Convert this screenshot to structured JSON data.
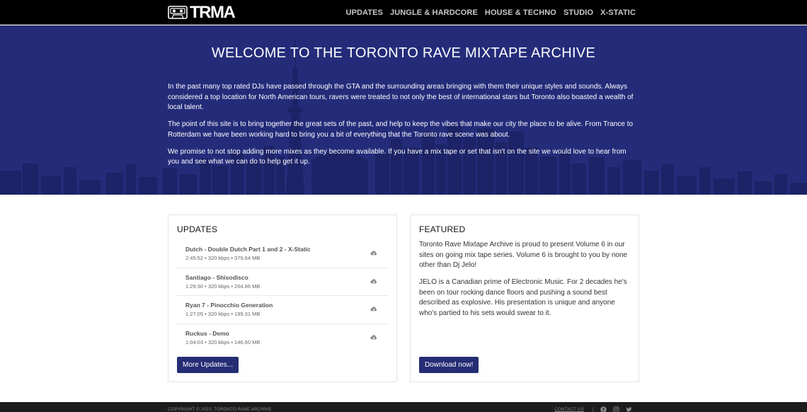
{
  "brand": {
    "logo_text": "TRMA"
  },
  "nav": {
    "items": [
      {
        "label": "UPDATES"
      },
      {
        "label": "JUNGLE & HARDCORE"
      },
      {
        "label": "HOUSE & TECHNO"
      },
      {
        "label": "STUDIO"
      },
      {
        "label": "X-STATIC"
      }
    ]
  },
  "hero": {
    "title": "WELCOME TO THE TORONTO RAVE MIXTAPE ARCHIVE",
    "paragraphs": [
      "In the past many top rated DJs have passed through the GTA and the surrounding areas bringing with them their unique styles and sounds. Always considered a top location for North American tours, ravers were treated to not only the best of international stars but Toronto also boasted a wealth of local talent.",
      "The point of this site is to bring together the great sets of the past, and help to keep the vibes that make our city the place to be alive. From Trance to Rotterdam we have been working hard to bring you a bit of everything that the Toronto rave scene was about.",
      "We promise to not stop adding more mixes as they become available. If you have a mix tape or set that isn't on the site we would love to hear from you and see what we can do to help get it up."
    ]
  },
  "updates": {
    "heading": "UPDATES",
    "items": [
      {
        "title": "Dutch - Double Dutch Part 1 and 2 - X-Static",
        "meta": "2:45:52 • 320 kbps • 379.64 MB"
      },
      {
        "title": "Santiago - Shisodisco",
        "meta": "1:29:30 • 320 kbps • 204.86 MB"
      },
      {
        "title": "Ryan 7 - Pinocchio Generation",
        "meta": "1:27:05 • 320 kbps • 199.31 MB"
      },
      {
        "title": "Ruckus - Demo",
        "meta": "1:04:03 • 320 kbps • 146.60 MB"
      }
    ],
    "button": "More Updates..."
  },
  "featured": {
    "heading": "FEATURED",
    "paragraphs": [
      "Toronto Rave Mixtape Archive is proud to present Volume 6 in our sites on going mix tape series. Volume 6 is brought to you by none other than Dj Jelo!",
      "JELO is a Canadian prime of Electronic Music. For 2 decades he's been on tour rocking dance floors and pushing a sound best described as explosive. His presentation is unique and anyone who's partied to his sets would swear to it."
    ],
    "button": "Download now!"
  },
  "footer": {
    "copyright": "COPYRIGHT © 2023, TORONTO RAVE ARCHIVE",
    "contact": "CONTACT US",
    "separator": "|",
    "socials": [
      "facebook-icon",
      "instagram-icon",
      "twitter-icon"
    ]
  },
  "colors": {
    "navbar": "#000000",
    "hero_bg": "#242c7a",
    "skyline": "#1c2366",
    "button": "#252d74",
    "footer": "#1c1c1c"
  }
}
